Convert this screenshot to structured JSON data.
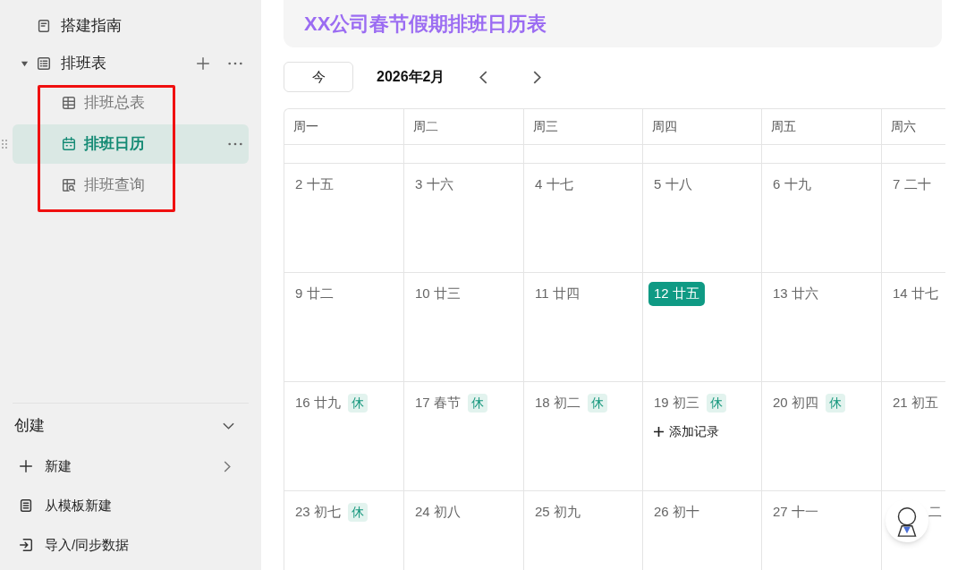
{
  "sidebar": {
    "items": [
      {
        "label": "搭建指南",
        "kind": "doc",
        "selected": false
      },
      {
        "label": "排班表",
        "kind": "list",
        "expanded": true,
        "selected": false,
        "children": [
          {
            "label": "排班总表",
            "kind": "table",
            "selected": false
          },
          {
            "label": "排班日历",
            "kind": "calendar",
            "selected": true
          },
          {
            "label": "排班查询",
            "kind": "query",
            "selected": false
          }
        ]
      }
    ],
    "create": {
      "title": "创建",
      "items": [
        {
          "label": "新建",
          "kind": "plus"
        },
        {
          "label": "从模板新建",
          "kind": "template"
        },
        {
          "label": "导入/同步数据",
          "kind": "import"
        }
      ]
    }
  },
  "title": "XX公司春节假期排班日历表",
  "toolbar": {
    "today": "今",
    "month": "2026年2月"
  },
  "calendar": {
    "weekdays": [
      "周一",
      "周二",
      "周三",
      "周四",
      "周五",
      "周六"
    ],
    "weeks": [
      [
        {
          "label": "2 十五",
          "today": false
        },
        {
          "label": "3 十六",
          "today": false
        },
        {
          "label": "4 十七",
          "today": false
        },
        {
          "label": "5 十八",
          "today": false
        },
        {
          "label": "6 十九",
          "today": false
        },
        {
          "label": "7 二十",
          "today": false
        }
      ],
      [
        {
          "label": "9 廿二",
          "today": false
        },
        {
          "label": "10 廿三",
          "today": false
        },
        {
          "label": "11 廿四",
          "today": false
        },
        {
          "label": "12 廿五",
          "today": true
        },
        {
          "label": "13 廿六",
          "today": false
        },
        {
          "label": "14 廿七",
          "today": false
        }
      ],
      [
        {
          "label": "16 廿九",
          "today": false,
          "tag": "休"
        },
        {
          "label": "17 春节",
          "today": false,
          "tag": "休"
        },
        {
          "label": "18 初二",
          "today": false,
          "tag": "休"
        },
        {
          "label": "19 初三",
          "today": false,
          "tag": "休",
          "add": "添加记录"
        },
        {
          "label": "20 初四",
          "today": false,
          "tag": "休"
        },
        {
          "label": "21 初五",
          "today": false
        }
      ],
      [
        {
          "label": "23 初七",
          "today": false,
          "tag": "休"
        },
        {
          "label": "24 初八",
          "today": false
        },
        {
          "label": "25 初九",
          "today": false
        },
        {
          "label": "26 初十",
          "today": false
        },
        {
          "label": "27 十一",
          "today": false
        },
        {
          "label": "二",
          "today": false,
          "kind": "covered"
        }
      ]
    ]
  }
}
